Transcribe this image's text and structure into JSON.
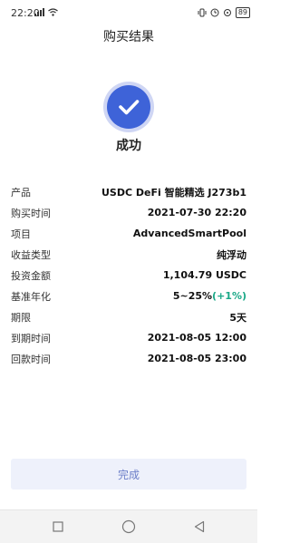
{
  "status_bar": {
    "time": "22:20",
    "battery": "89"
  },
  "page": {
    "title": "购买结果"
  },
  "result": {
    "status_text": "成功",
    "accent_color": "#3e63d8"
  },
  "details": [
    {
      "label": "产品",
      "value": "USDC DeFi 智能精选 J273b1"
    },
    {
      "label": "购买时间",
      "value": "2021-07-30 22:20"
    },
    {
      "label": "项目",
      "value": "AdvancedSmartPool"
    },
    {
      "label": "收益类型",
      "value": "纯浮动"
    },
    {
      "label": "投资金额",
      "value": "1,104.79 USDC"
    },
    {
      "label": "基准年化",
      "value": "5~25%",
      "extra": "(+1%)"
    },
    {
      "label": "期限",
      "value": "5天"
    },
    {
      "label": "到期时间",
      "value": "2021-08-05 12:00"
    },
    {
      "label": "回款时间",
      "value": "2021-08-05 23:00"
    }
  ],
  "footer": {
    "done_label": "完成"
  },
  "navigation": {
    "icons": [
      "square-recents-icon",
      "circle-home-icon",
      "triangle-back-icon"
    ]
  }
}
